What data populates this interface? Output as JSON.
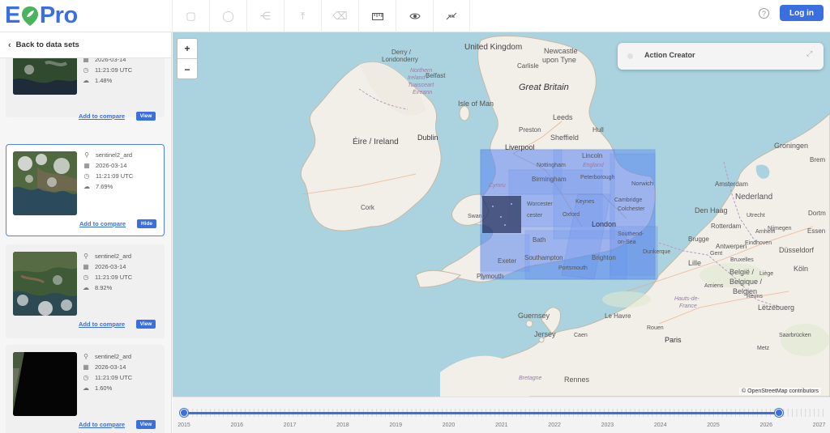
{
  "app": {
    "logo_text": [
      "E",
      "Pro"
    ]
  },
  "header": {
    "tools": [
      {
        "icon": "square-select-icon",
        "glyph": "▢",
        "active": false
      },
      {
        "icon": "circle-select-icon",
        "glyph": "◯",
        "active": false
      },
      {
        "icon": "polygon-select-icon",
        "glyph": "⋲",
        "active": false
      },
      {
        "icon": "upload-icon",
        "glyph": "⤒",
        "active": false
      },
      {
        "icon": "eraser-icon",
        "glyph": "⌫",
        "active": false
      },
      {
        "icon": "ruler-icon",
        "glyph": "▭",
        "active": true
      },
      {
        "icon": "eye-icon",
        "glyph": "◉",
        "active": true
      },
      {
        "icon": "collapse-icon",
        "glyph": "⇲",
        "active": true
      }
    ],
    "help_glyph": "?",
    "login_label": "Log in"
  },
  "sidebar": {
    "back_label": "Back to data sets",
    "cards": [
      {
        "dataset": "",
        "date": "2026-03-14",
        "time": "11:21:09 UTC",
        "cloud": "1.48%",
        "compare": "Add to compare",
        "action": "View",
        "selected": false
      },
      {
        "dataset": "sentinel2_ard",
        "date": "2026-03-14",
        "time": "11:21:09 UTC",
        "cloud": "7.69%",
        "compare": "Add to compare",
        "action": "Hide",
        "selected": true
      },
      {
        "dataset": "sentinel2_ard",
        "date": "2026-03-14",
        "time": "11:21:09 UTC",
        "cloud": "8.92%",
        "compare": "Add to compare",
        "action": "View",
        "selected": false
      },
      {
        "dataset": "sentinel2_ard",
        "date": "2026-03-14",
        "time": "11:21:09 UTC",
        "cloud": "1.60%",
        "compare": "Add to compare",
        "action": "View",
        "selected": false
      }
    ]
  },
  "map": {
    "zoom_in": "+",
    "zoom_out": "−",
    "action_creator_label": "Action Creator",
    "attribution": "© OpenStreetMap contributors",
    "labels": {
      "united_kingdom": "United Kingdom",
      "great_britain": "Great Britain",
      "derry": "Derry /",
      "londonderry": "Londonderry",
      "northern_ireland": "Northern",
      "northern_ireland_2": "Ireland /",
      "tuaisceart": "Tuaisceart",
      "eireann": "Éireann",
      "belfast": "Belfast",
      "isle_of_man": "Isle of Man",
      "eire": "Éire / Ireland",
      "dublin": "Dublin",
      "cork": "Cork",
      "carlisle": "Carlisle",
      "newcastle": "Newcastle",
      "newcastle_2": "upon Tyne",
      "preston": "Preston",
      "leeds": "Leeds",
      "sheffield": "Sheffield",
      "liverpool": "Liverpool",
      "hull": "Hull",
      "lincoln": "Lincoln",
      "nottingham": "Nottingham",
      "england": "England",
      "peterborough": "Peterborough",
      "norwich": "Norwich",
      "birmingham": "Birmingham",
      "cymru": "Cymru",
      "cambridge": "Cambridge",
      "keynes": "Keynes",
      "worcester": "Worcester",
      "colchester": "Colchester",
      "oxford": "Oxford",
      "gloucester": "cester",
      "swansea": "Swan",
      "london": "London",
      "southend": "Southend-",
      "southend_2": "on-Sea",
      "bath": "Bath",
      "exeter": "Exeter",
      "southampton": "Southampton",
      "portsmouth": "Portsmouth",
      "brighton": "Brighton",
      "plymouth": "Plymouth",
      "dunkerque": "Dunkerque",
      "guernsey": "Guernsey",
      "jersey": "Jersey",
      "le_havre": "Le Havre",
      "rouen": "Rouen",
      "caen": "Caen",
      "lille": "Lille",
      "paris": "Paris",
      "rennes": "Rennes",
      "bretagne": "Bretagne",
      "hauts": "Hauts-de-",
      "hauts_2": "France",
      "groningen": "Groningen",
      "nederland": "Nederland",
      "amsterdam": "Amsterdam",
      "den_haag": "Den Haag",
      "rotterdam": "Rotterdam",
      "utrecht": "Utrecht",
      "eindhoven": "Eindhoven",
      "nijmegen": "Nijmegen",
      "antwerpen": "Antwerpen",
      "brugge": "Brugge",
      "gent": "Gent",
      "belgie": "België /",
      "belgique": "Belgique /",
      "belgien": "Belgien",
      "bruxelles": "Bruxelles",
      "dusseldorf": "Düsseldorf",
      "koln": "Köln",
      "luxembourg": "Lëtzebuerg",
      "saarbrucken": "Saarbrücken",
      "metz": "Metz",
      "reims": "Reims",
      "amiens": "Amiens",
      "liege": "Liège",
      "bremen": "Brem",
      "essen": "Essen",
      "dortmund": "Dortm",
      "arnhem": "Arnhem"
    }
  },
  "timeline": {
    "years": [
      "2015",
      "2016",
      "2017",
      "2018",
      "2019",
      "2020",
      "2021",
      "2022",
      "2023",
      "2024",
      "2025",
      "2026",
      "2027"
    ],
    "range_start": "2015",
    "range_end": "2026"
  },
  "colors": {
    "accent": "#3b6fe0",
    "footprint": "#4f7ff0",
    "sea": "#aad3df",
    "land": "#f2efe9"
  }
}
